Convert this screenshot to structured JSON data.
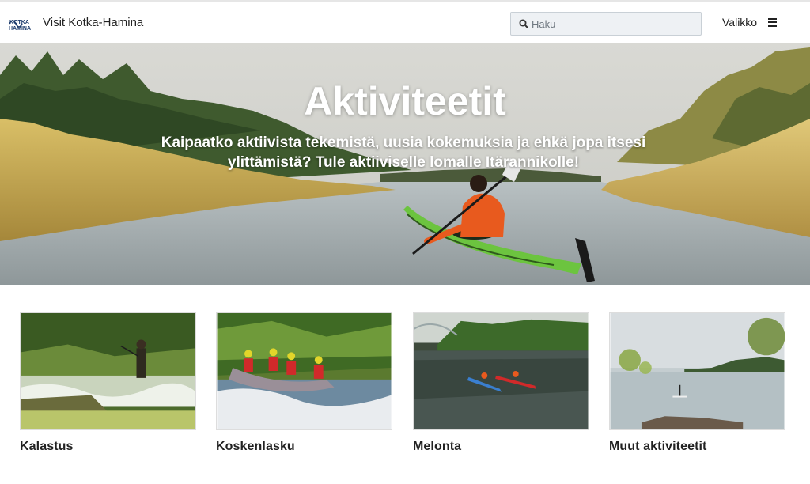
{
  "header": {
    "logo_text_top": "KOTKA",
    "logo_text_bottom": "HAMINA",
    "site_title": "Visit Kotka-Hamina",
    "search_placeholder": "Haku",
    "menu_label": "Valikko",
    "icons": {
      "search": "search-icon",
      "menu": "hamburger-menu-icon"
    }
  },
  "hero": {
    "title": "Aktiviteetit",
    "subtitle": "Kaipaatko aktiivista tekemistä, uusia kokemuksia ja ehkä jopa itsesi ylittämistä? Tule aktiiviselle lomalle Itärannikolle!",
    "colors": {
      "reeds": "#c9a845",
      "water": "#a9b2b6",
      "kayak": "#6cc43f",
      "jacket": "#e85a1e"
    }
  },
  "cards": [
    {
      "label": "Kalastus"
    },
    {
      "label": "Koskenlasku"
    },
    {
      "label": "Melonta"
    },
    {
      "label": "Muut aktiviteetit"
    }
  ]
}
